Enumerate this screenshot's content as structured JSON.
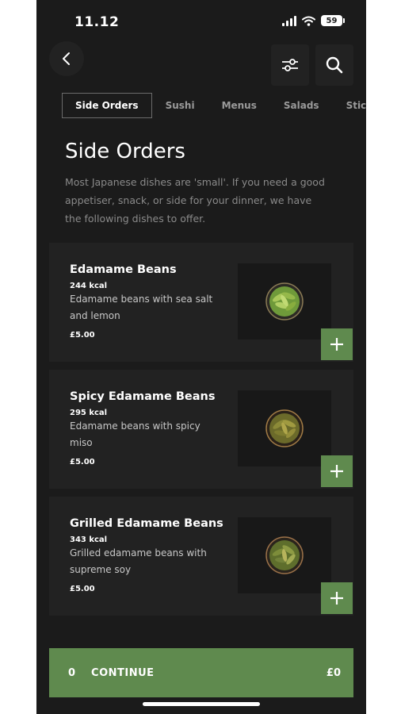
{
  "status_bar": {
    "time": "11.12",
    "battery": "59"
  },
  "tabs": [
    {
      "label": "Side Orders",
      "active": true
    },
    {
      "label": "Sushi",
      "active": false
    },
    {
      "label": "Menus",
      "active": false
    },
    {
      "label": "Salads",
      "active": false
    },
    {
      "label": "Sticks",
      "active": false
    }
  ],
  "page": {
    "title": "Side Orders",
    "description": "Most Japanese dishes are 'small'. If you need a good appetiser, snack, or side for your dinner, we have the following dishes to offer."
  },
  "items": [
    {
      "name": "Edamame Beans",
      "kcal": "244 kcal",
      "description": "Edamame beans with sea salt and lemon",
      "price": "£5.00"
    },
    {
      "name": "Spicy Edamame Beans",
      "kcal": "295 kcal",
      "description": "Edamame beans with spicy miso",
      "price": "£5.00"
    },
    {
      "name": "Grilled Edamame Beans",
      "kcal": "343 kcal",
      "description": "Grilled edamame beans with supreme soy",
      "price": "£5.00"
    }
  ],
  "basket": {
    "count": "0",
    "label": "CONTINUE",
    "total": "£0"
  },
  "icons": {
    "back": "chevron-left-icon",
    "filter": "sliders-icon",
    "search": "search-icon",
    "add": "plus-icon"
  },
  "colors": {
    "background": "#1b1b1b",
    "card": "#222222",
    "accent_green": "#5f8a4e",
    "text_primary": "#ffffff",
    "text_muted": "#8a8a8a"
  }
}
